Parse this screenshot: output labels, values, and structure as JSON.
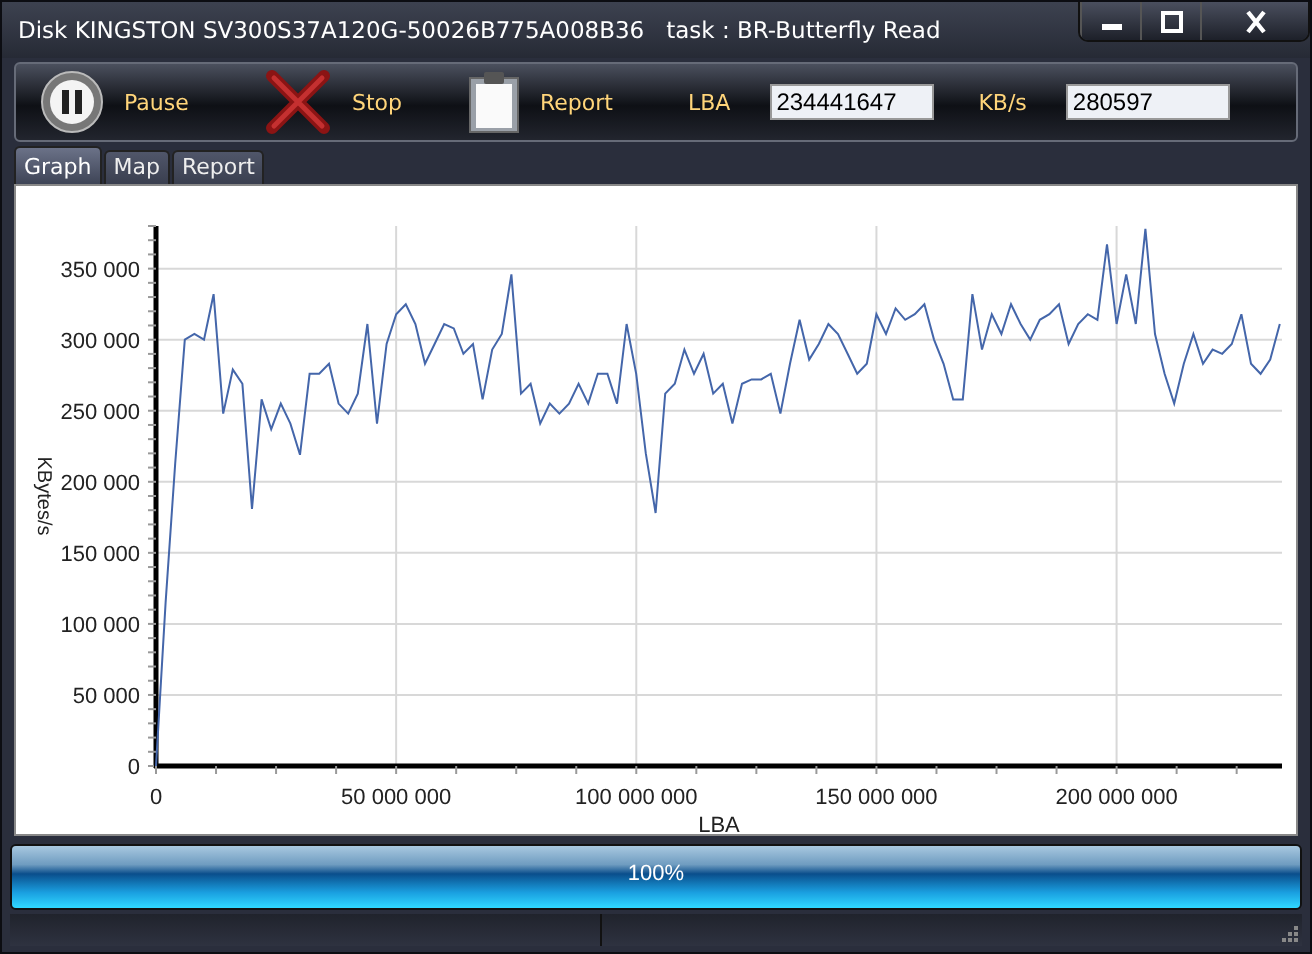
{
  "window": {
    "title": "Disk KINGSTON SV300S37A120G-50026B775A008B36   task : BR-Butterfly Read"
  },
  "toolbar": {
    "buttons": [
      {
        "kind": "pause",
        "label": "Pause"
      },
      {
        "kind": "stop",
        "label": "Stop"
      },
      {
        "kind": "report",
        "label": "Report"
      }
    ],
    "fields": [
      {
        "label": "LBA",
        "value": "234441647"
      },
      {
        "label": "KB/s",
        "value": "280597"
      }
    ]
  },
  "tabs": [
    {
      "label": "Graph",
      "selected": true
    },
    {
      "label": "Map",
      "selected": false
    },
    {
      "label": "Report",
      "selected": false
    }
  ],
  "graph": {
    "chart_data": {
      "type": "line",
      "xlabel": "LBA",
      "ylabel": "KBytes/s",
      "xlim": [
        0,
        234441647
      ],
      "ylim": [
        0,
        380000
      ],
      "grid": true,
      "xticks": [
        {
          "value": 0,
          "label": "0"
        },
        {
          "value": 50000000,
          "label": "50 000 000"
        },
        {
          "value": 100000000,
          "label": "100 000 000"
        },
        {
          "value": 150000000,
          "label": "150 000 000"
        },
        {
          "value": 200000000,
          "label": "200 000 000"
        }
      ],
      "yticks": [
        {
          "value": 0,
          "label": "0"
        },
        {
          "value": 50000,
          "label": "50 000"
        },
        {
          "value": 100000,
          "label": "100 000"
        },
        {
          "value": 150000,
          "label": "150 000"
        },
        {
          "value": 200000,
          "label": "200 000"
        },
        {
          "value": 250000,
          "label": "250 000"
        },
        {
          "value": 300000,
          "label": "300 000"
        },
        {
          "value": 350000,
          "label": "350 000"
        }
      ],
      "x": [
        0,
        2000000,
        4000000,
        6000000,
        8000000,
        10000000,
        12000000,
        14000000,
        16000000,
        18000000,
        20000000,
        22000000,
        24000000,
        26000000,
        28000000,
        30000000,
        32000000,
        34000000,
        36000000,
        38000000,
        40000000,
        42000000,
        44000000,
        46000000,
        48000000,
        50000000,
        52000000,
        54000000,
        56000000,
        58000000,
        60000000,
        62000000,
        64000000,
        66000000,
        68000000,
        70000000,
        72000000,
        74000000,
        76000000,
        78000000,
        80000000,
        82000000,
        84000000,
        86000000,
        88000000,
        90000000,
        92000000,
        94000000,
        96000000,
        98000000,
        100000000,
        102000000,
        104000000,
        106000000,
        108000000,
        110000000,
        112000000,
        114000000,
        116000000,
        118000000,
        120000000,
        122000000,
        124000000,
        126000000,
        128000000,
        130000000,
        132000000,
        134000000,
        136000000,
        138000000,
        140000000,
        142000000,
        144000000,
        146000000,
        148000000,
        150000000,
        152000000,
        154000000,
        156000000,
        158000000,
        160000000,
        162000000,
        164000000,
        166000000,
        168000000,
        170000000,
        172000000,
        174000000,
        176000000,
        178000000,
        180000000,
        182000000,
        184000000,
        186000000,
        188000000,
        190000000,
        192000000,
        194000000,
        196000000,
        198000000,
        200000000,
        202000000,
        204000000,
        206000000,
        208000000,
        210000000,
        212000000,
        214000000,
        216000000,
        218000000,
        220000000,
        222000000,
        224000000,
        226000000,
        228000000,
        230000000,
        232000000,
        234000000
      ],
      "series": [
        {
          "color": "#4466aa",
          "values": [
            0,
            115000,
            213000,
            300000,
            304000,
            300000,
            332000,
            248000,
            279000,
            269000,
            181000,
            258000,
            237000,
            255000,
            241000,
            219000,
            276000,
            276000,
            283000,
            255000,
            248000,
            262000,
            311000,
            241000,
            297000,
            318000,
            325000,
            311000,
            283000,
            297000,
            311000,
            308000,
            290000,
            297000,
            258000,
            293000,
            304000,
            346000,
            262000,
            269000,
            241000,
            255000,
            248000,
            255000,
            269000,
            255000,
            276000,
            276000,
            255000,
            311000,
            276000,
            220000,
            178000,
            262000,
            269000,
            293000,
            276000,
            290000,
            262000,
            269000,
            241000,
            269000,
            272000,
            272000,
            276000,
            248000,
            283000,
            314000,
            286000,
            297000,
            311000,
            304000,
            290000,
            276000,
            283000,
            318000,
            304000,
            322000,
            314000,
            318000,
            325000,
            300000,
            283000,
            258000,
            258000,
            332000,
            293000,
            318000,
            304000,
            325000,
            311000,
            300000,
            314000,
            318000,
            325000,
            297000,
            311000,
            318000,
            314000,
            367000,
            311000,
            346000,
            311000,
            378000,
            304000,
            276000,
            255000,
            283000,
            304000,
            283000,
            293000,
            290000,
            297000,
            318000,
            283000,
            276000,
            286000,
            311000
          ]
        }
      ]
    }
  },
  "progress": {
    "level": 1,
    "label": "100%"
  }
}
